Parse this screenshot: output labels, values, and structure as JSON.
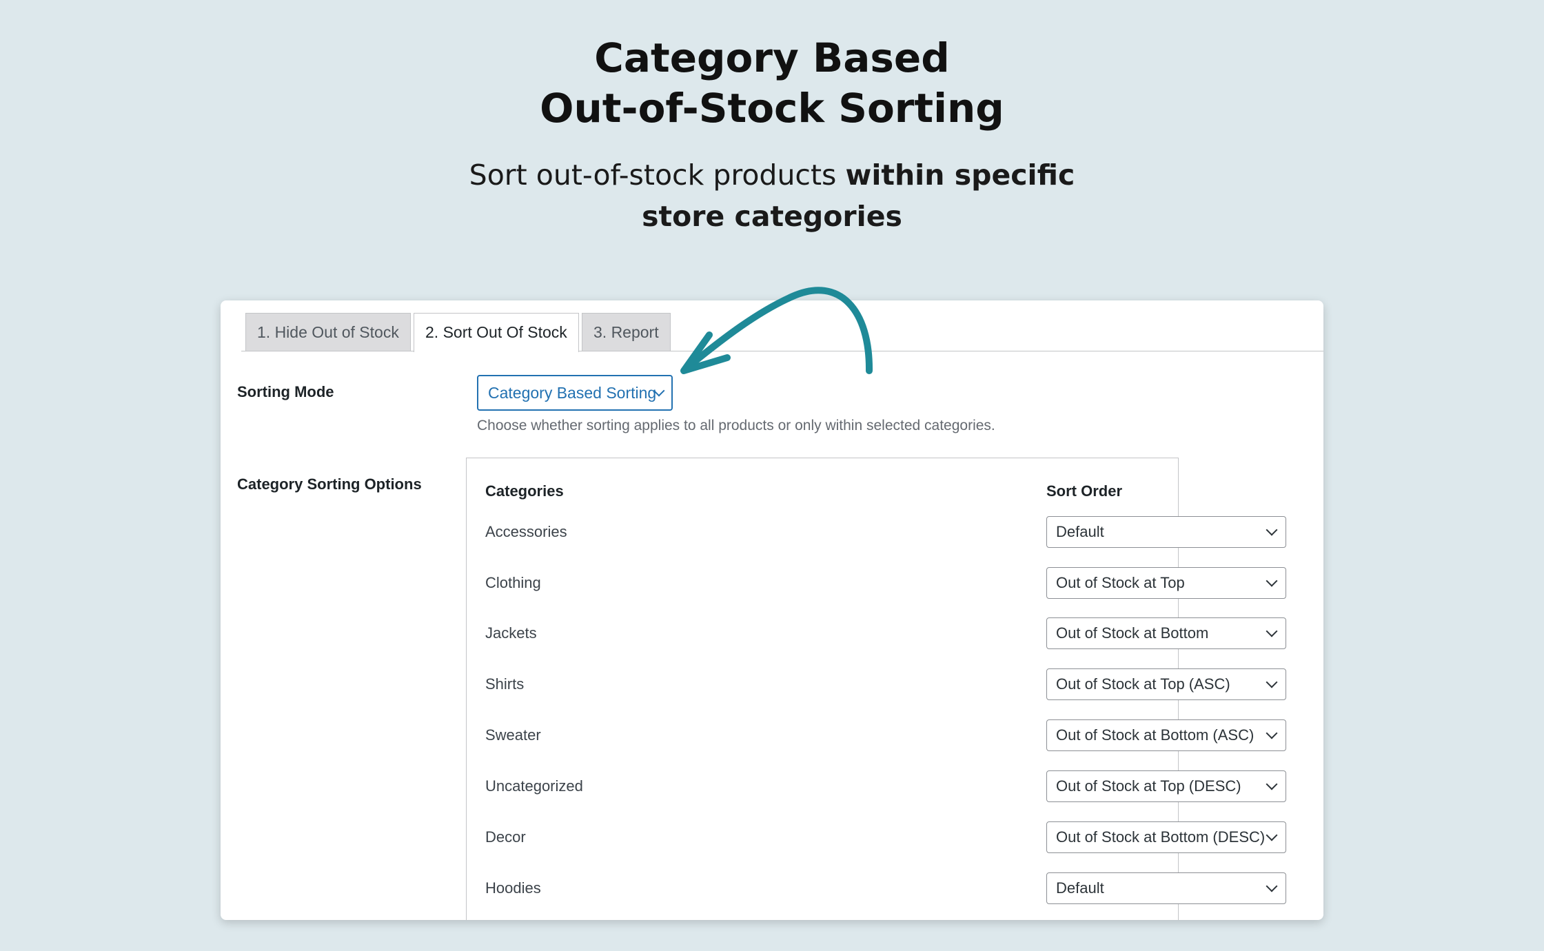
{
  "hero": {
    "title_line1": "Category Based",
    "title_line2": "Out-of-Stock Sorting",
    "subtitle_plain": "Sort out-of-stock products ",
    "subtitle_bold1": "within specific",
    "subtitle_bold2": "store categories"
  },
  "tabs": [
    {
      "label": "1. Hide Out of Stock",
      "active": false
    },
    {
      "label": "2. Sort Out Of Stock",
      "active": true
    },
    {
      "label": "3. Report",
      "active": false
    }
  ],
  "sorting_mode": {
    "label": "Sorting Mode",
    "value": "Category Based Sorting",
    "description": "Choose whether sorting applies to all products or only within selected categories."
  },
  "category_options": {
    "label": "Category Sorting Options",
    "col_categories": "Categories",
    "col_sort_order": "Sort Order",
    "rows": [
      {
        "category": "Accessories",
        "order": "Default"
      },
      {
        "category": "Clothing",
        "order": "Out of Stock at Top"
      },
      {
        "category": "Jackets",
        "order": "Out of Stock at Bottom"
      },
      {
        "category": "Shirts",
        "order": "Out of Stock at Top (ASC)"
      },
      {
        "category": "Sweater",
        "order": "Out of Stock at Bottom (ASC)"
      },
      {
        "category": "Uncategorized",
        "order": "Out of Stock at Top (DESC)"
      },
      {
        "category": "Decor",
        "order": "Out of Stock at Bottom (DESC)"
      },
      {
        "category": "Hoodies",
        "order": "Default"
      }
    ]
  },
  "colors": {
    "background": "#dde8ec",
    "accent": "#2271b1",
    "arrow": "#1f8a98"
  },
  "icons": {
    "select_chevron": "chevron-down-icon",
    "pointer_arrow": "curved-arrow-icon"
  }
}
